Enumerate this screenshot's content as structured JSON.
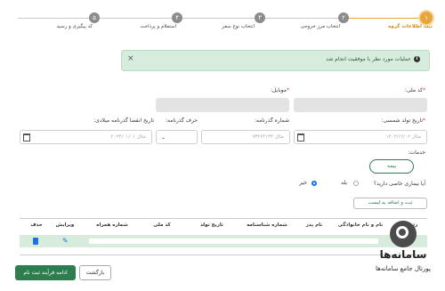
{
  "stepper": {
    "steps": [
      {
        "num": "۱",
        "label": "ثبت اطلاعات گروه",
        "active": true
      },
      {
        "num": "۲",
        "label": "انتخاب مرز خروجی",
        "active": false
      },
      {
        "num": "۳",
        "label": "انتخاب نوع سفر",
        "active": false
      },
      {
        "num": "۴",
        "label": "استعلام و پرداخت",
        "active": false
      },
      {
        "num": "۵",
        "label": "کد پیگیری و رسید",
        "active": false
      }
    ]
  },
  "alert": {
    "text": "عملیات مورد نظر با موفقیت انجام شد",
    "icon": "info-icon",
    "close": "×"
  },
  "form": {
    "national_code_label": "کد ملی:",
    "mobile_label": "موبایل:",
    "birthdate_label": "تاریخ تولد شمسی:",
    "birthdate_placeholder": "مثال ۱۴۰۲/۱۲/۰۲",
    "id_number_label": "شماره گذرنامه:",
    "id_number_placeholder": "مثال ۹۳۴۶۴۱۳۴",
    "passport_letter_label": "حرف گذرنامه:",
    "passport_expiry_label": "تاریخ انقضا گذرنامه میلادی:",
    "passport_expiry_placeholder": "مثال ۲۰۲۴/۰۱/۰۱",
    "services_label": "خدمات:",
    "insurance_pill": "بیمه",
    "disease_question": "آیا بیماری خاصی دارید؟",
    "yes_label": "بله",
    "no_label": "خیر",
    "add_to_list_button": "ثبت و اضافه به لیست"
  },
  "table": {
    "headers": [
      "حذف",
      "ویرایش",
      "شماره همراه",
      "کد ملی",
      "تاریخ تولد",
      "شماره شناسنامه",
      "نام پدر",
      "نام و نام خانوادگی",
      "ردیف"
    ]
  },
  "footer": {
    "continue_button": "ادامه فرآیند ثبت نام",
    "back_button": "بازگشت"
  },
  "logo": {
    "name": "سامانه‌ها",
    "subtitle": "پورتال جامع سامانه‌ها"
  },
  "colors": {
    "accent": "#e8a63a",
    "primary": "#2e7d4f",
    "alert_bg": "#d7ecdd",
    "link": "#1a73e8"
  }
}
